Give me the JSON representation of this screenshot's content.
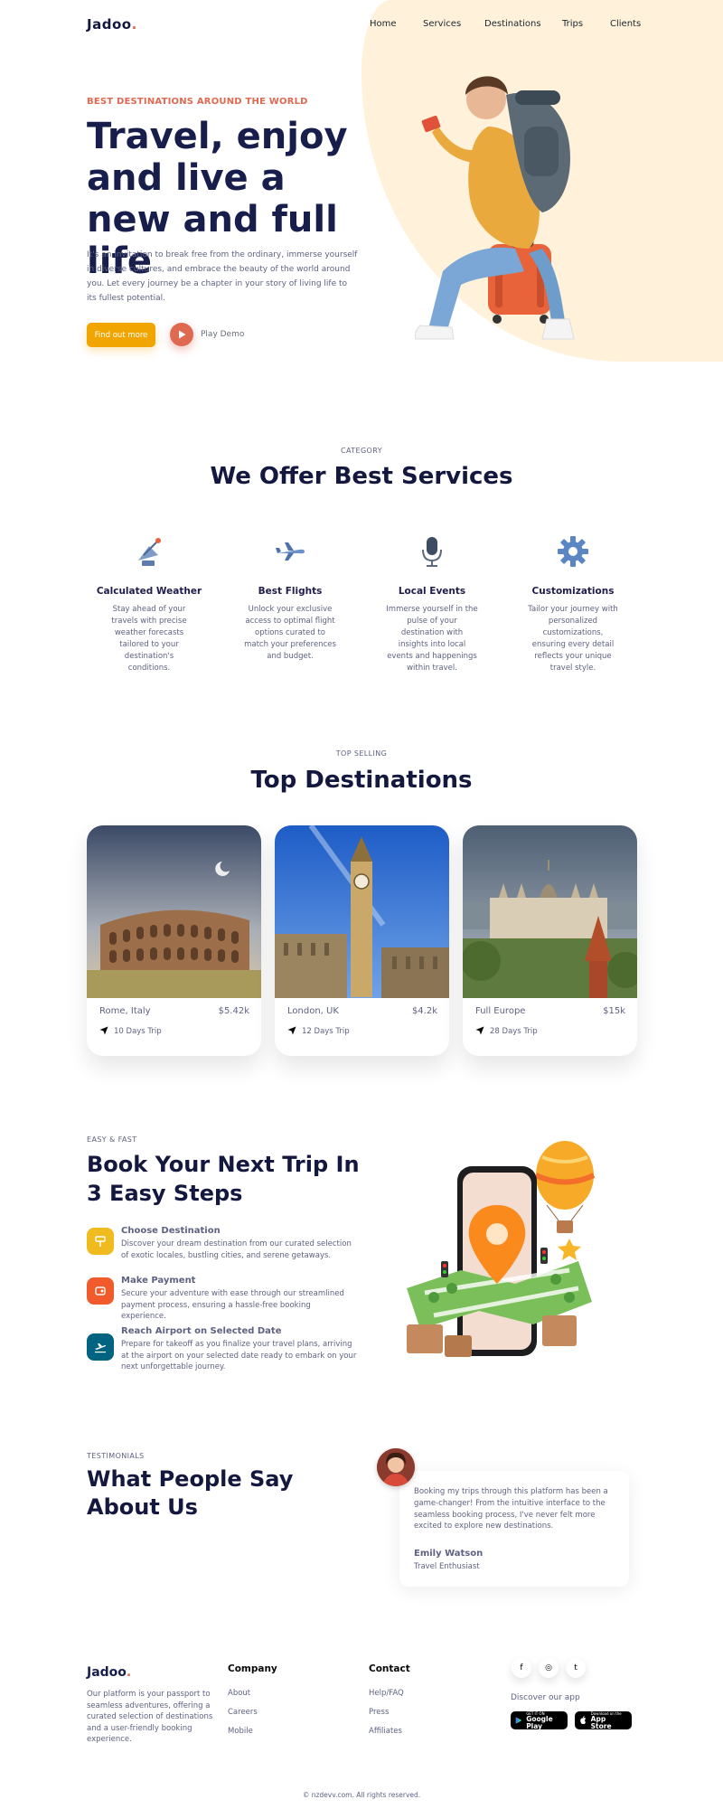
{
  "brand": {
    "name": "Jadoo",
    "dot": "."
  },
  "nav": {
    "items": [
      "Home",
      "Services",
      "Destinations",
      "Trips",
      "Clients"
    ]
  },
  "hero": {
    "eyebrow": "BEST DESTINATIONS AROUND THE WORLD",
    "title": "Travel, enjoy and live a new and full life",
    "description": "It's an invitation to break free from the ordinary, immerse yourself in diverse cultures, and embrace the beauty of the world around you. Let every journey be a chapter in your story of living life to its fullest potential.",
    "cta": "Find out more",
    "play_label": "Play Demo"
  },
  "services": {
    "subtitle": "CATEGORY",
    "title": "We Offer Best Services",
    "items": [
      {
        "icon": "satellite-dish-icon",
        "title": "Calculated Weather",
        "text": "Stay ahead of your travels with precise weather forecasts tailored to your destination's conditions."
      },
      {
        "icon": "airplane-icon",
        "title": "Best Flights",
        "text": "Unlock your exclusive access to optimal flight options curated to match your preferences and budget."
      },
      {
        "icon": "microphone-icon",
        "title": "Local Events",
        "text": "Immerse yourself in the pulse of your destination with insights into local events and happenings within travel."
      },
      {
        "icon": "gear-icon",
        "title": "Customizations",
        "text": "Tailor your journey with personalized customizations, ensuring every detail reflects your unique travel style."
      }
    ]
  },
  "destinations": {
    "subtitle": "TOP SELLING",
    "title": "Top Destinations",
    "cards": [
      {
        "name": "Rome, Italy",
        "price": "$5.42k",
        "trip": "10 Days Trip"
      },
      {
        "name": "London, UK",
        "price": "$4.2k",
        "trip": "12 Days Trip"
      },
      {
        "name": "Full Europe",
        "price": "$15k",
        "trip": "28 Days Trip"
      }
    ]
  },
  "book": {
    "subtitle": "EASY & FAST",
    "title": "Book Your Next Trip In 3 Easy Steps",
    "steps": [
      {
        "title": "Choose Destination",
        "text": "Discover your dream destination from our curated selection of exotic locales, bustling cities, and serene getaways.",
        "color": "#F0BB1F"
      },
      {
        "title": "Make Payment",
        "text": "Secure your adventure with ease through our streamlined payment process, ensuring a hassle-free booking experience.",
        "color": "#F15A2B"
      },
      {
        "title": "Reach Airport on Selected Date",
        "text": "Prepare for takeoff as you finalize your travel plans, arriving at the airport on your selected date ready to embark on your next unforgettable journey.",
        "color": "#006380"
      }
    ]
  },
  "testimonials": {
    "subtitle": "TESTIMONIALS",
    "title": "What People Say About Us",
    "quote": "Booking my trips through this platform has been a game-changer! From the intuitive interface to the seamless booking process, I've never felt more excited to explore new destinations.",
    "name": "Emily Watson",
    "role": "Travel Enthusiast"
  },
  "footer": {
    "description": "Our platform is your passport to seamless adventures, offering a curated selection of destinations and a user-friendly booking experience.",
    "company": {
      "heading": "Company",
      "links": [
        "About",
        "Careers",
        "Mobile"
      ]
    },
    "contact": {
      "heading": "Contact",
      "links": [
        "Help/FAQ",
        "Press",
        "Affiliates"
      ]
    },
    "social": [
      "f",
      "◎",
      "t"
    ],
    "app_heading": "Discover our app",
    "google": {
      "small": "GET IT ON",
      "big": "Google Play"
    },
    "apple": {
      "small": "Download on the",
      "big": "App Store"
    },
    "copyright": "© nzdevv.com. All rights reserved."
  },
  "colors": {
    "accent": "#DF6951",
    "yellow": "#F1A501",
    "heading": "#181E4B",
    "body": "#5E6282",
    "blob": "#FFF1DA"
  }
}
